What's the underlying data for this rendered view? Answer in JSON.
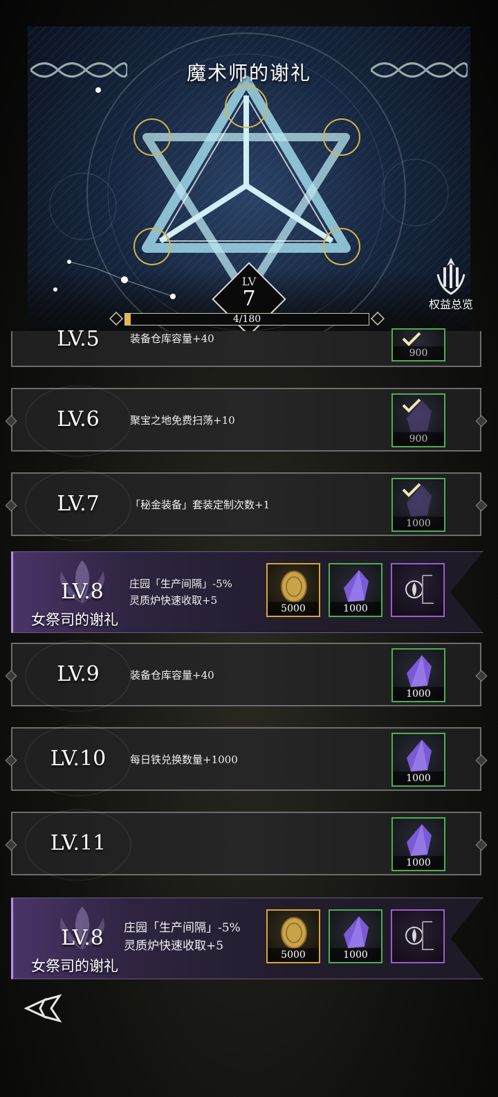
{
  "header": {
    "title": "魔术师的谢礼",
    "level_prefix": "LV",
    "level_value": "7",
    "progress_text": "4/180",
    "progress_fraction": 0.022,
    "benefits_label": "权益总览"
  },
  "rows": [
    {
      "level": "LV.5",
      "desc": "装备仓库容量+40",
      "qty": "900",
      "claimed": true
    },
    {
      "level": "LV.6",
      "desc": "聚宝之地免费扫荡+10",
      "qty": "900",
      "claimed": true
    },
    {
      "level": "LV.7",
      "desc": "「秘金装备」套装定制次数+1",
      "qty": "1000",
      "claimed": true
    },
    {
      "level": "LV.9",
      "desc": "装备仓库容量+40",
      "qty": "1000",
      "claimed": false
    },
    {
      "level": "LV.10",
      "desc": "每日铁兑换数量+1000",
      "qty": "1000",
      "claimed": false
    },
    {
      "level": "LV.11",
      "desc": "",
      "qty": "1000",
      "claimed": false
    }
  ],
  "special_rows": [
    {
      "level": "LV.8",
      "subtitle": "女祭司的谢礼",
      "desc_line1": "庄园「生产间隔」-5%",
      "desc_line2": "灵质炉快速收取+5",
      "coin_qty": "5000",
      "crystal_qty": "1000"
    },
    {
      "level": "LV.8",
      "subtitle": "女祭司的谢礼",
      "desc_line1": "庄园「生产间隔」-5%",
      "desc_line2": "灵质炉快速收取+5",
      "coin_qty": "5000",
      "crystal_qty": "1000"
    }
  ],
  "colors": {
    "accent_gold": "#e3b54d",
    "claimed_border": "#4caf50",
    "special_purple": "#9b5bd6"
  },
  "icons": [
    "crystal-icon",
    "coin-icon",
    "check-icon",
    "priestess-emblem-icon",
    "benefits-icon",
    "game-logo-icon"
  ]
}
